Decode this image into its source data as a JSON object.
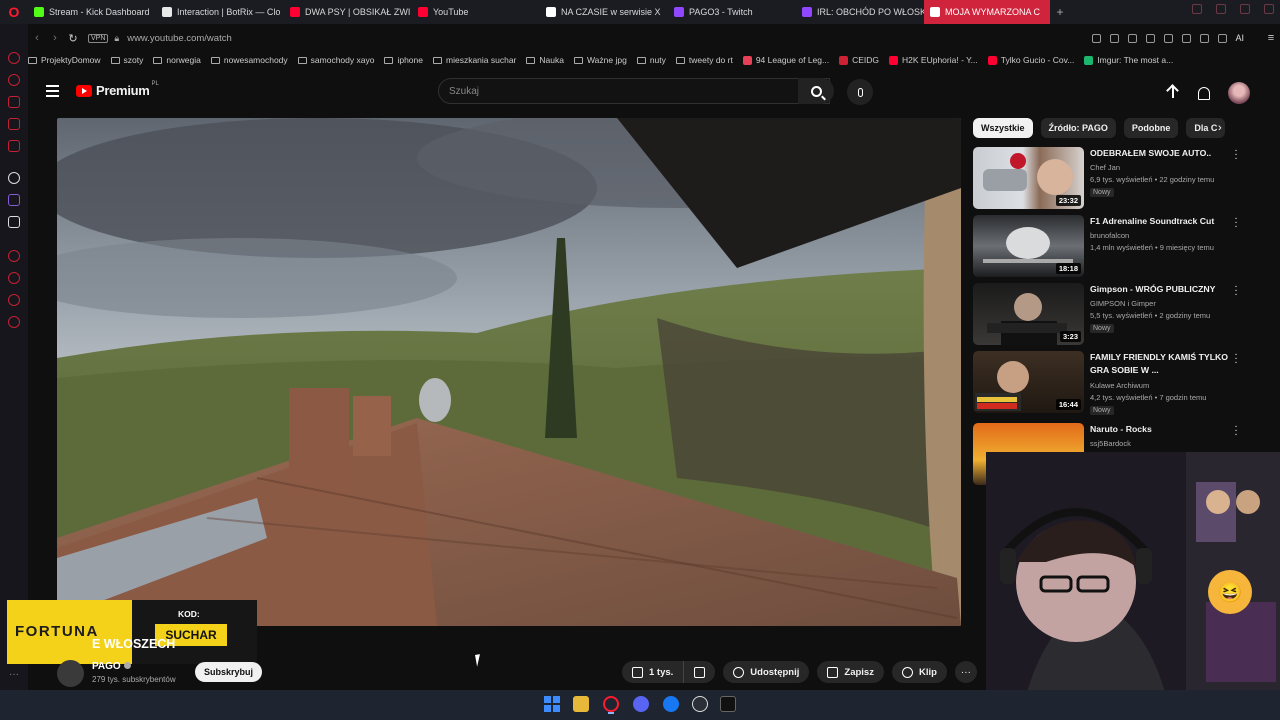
{
  "browser": {
    "tabs": [
      {
        "label": "Stream - Kick Dashboard",
        "color": "#53fc18"
      },
      {
        "label": "Interaction | BotRix — Clo",
        "color": "#e8e8e8"
      },
      {
        "label": "DWA PSY | OBSIKAŁ ZWI",
        "color": "#ff0033"
      },
      {
        "label": "YouTube",
        "color": "#ff0033"
      },
      {
        "label": "NA CZASIE w serwisie X",
        "color": "#ffffff"
      },
      {
        "label": "PAGO3 - Twitch",
        "color": "#9146ff"
      },
      {
        "label": "IRL: OBCHÓD PO WŁOSK",
        "color": "#9146ff"
      },
      {
        "label": "MOJA WYMARZONA C",
        "color": "#ff0033"
      }
    ],
    "url": "www.youtube.com/watch",
    "vpn_label": "VPN",
    "ai_label": "AI",
    "bookmarks": [
      {
        "label": "ProjektyDomow",
        "type": "folder"
      },
      {
        "label": "szoty",
        "type": "folder"
      },
      {
        "label": "norwegia",
        "type": "folder"
      },
      {
        "label": "nowesamochody",
        "type": "folder"
      },
      {
        "label": "samochody xayo",
        "type": "folder"
      },
      {
        "label": "iphone",
        "type": "folder"
      },
      {
        "label": "mieszkania suchar",
        "type": "folder"
      },
      {
        "label": "Nauka",
        "type": "folder"
      },
      {
        "label": "Ważne jpg",
        "type": "folder"
      },
      {
        "label": "nuty",
        "type": "folder"
      },
      {
        "label": "tweety do rt",
        "type": "folder"
      },
      {
        "label": "94 League of Leg...",
        "type": "site",
        "color": "#e84057"
      },
      {
        "label": "CEIDG",
        "type": "site",
        "color": "#cc2233"
      },
      {
        "label": "H2K EUphoria! - Y...",
        "type": "site",
        "color": "#ff0033"
      },
      {
        "label": "Tylko Gucio - Cov...",
        "type": "site",
        "color": "#ff0033"
      },
      {
        "label": "Imgur: The most a...",
        "type": "site",
        "color": "#1bb76e"
      }
    ]
  },
  "youtube": {
    "logo_text": "Premium",
    "country": "PL",
    "search_placeholder": "Szukaj",
    "video": {
      "title": "E WŁOSZECH",
      "channel": "PAGO",
      "subscribers": "279 tys. subskrybentów",
      "subscribe_label": "Subskrybuj",
      "likes": "1 tys.",
      "share_label": "Udostępnij",
      "save_label": "Zapisz",
      "clip_label": "Klip",
      "more_label": "···"
    },
    "chips": [
      "Wszystkie",
      "Źródło: PAGO",
      "Podobne",
      "Dla C"
    ],
    "recommendations": [
      {
        "title": "ODEBRAŁEM SWOJE AUTO..",
        "channel": "Chef Jan",
        "meta": "6,9 tys. wyświetleń • 22 godziny temu",
        "badge": "Nowy",
        "duration": "23:32"
      },
      {
        "title": "F1 Adrenaline Soundtrack Cut",
        "channel": "brunofalcon",
        "meta": "1,4 mln wyświetleń • 9 miesięcy temu",
        "badge": "",
        "duration": "18:18"
      },
      {
        "title": "Gimpson - WRÓG PUBLICZNY",
        "channel": "GIMPSON i Gimper",
        "meta": "5,5 tys. wyświetleń • 2 godziny temu",
        "badge": "Nowy",
        "duration": "3:23"
      },
      {
        "title": "FAMILY FRIENDLY KAMIŚ TYLKO GRA SOBIE W ...",
        "channel": "Kulawe Archiwum",
        "meta": "4,2 tys. wyświetleń • 7 godzin temu",
        "badge": "Nowy",
        "duration": "16:44"
      },
      {
        "title": "Naruto - Rocks",
        "channel": "ssj5Bardock",
        "meta": "",
        "badge": "",
        "duration": ""
      }
    ]
  },
  "sponsor": {
    "brand": "FORTUNA",
    "code_label": "KOD:",
    "code": "SUCHAR"
  },
  "overlay": {
    "emoji": "😆"
  }
}
